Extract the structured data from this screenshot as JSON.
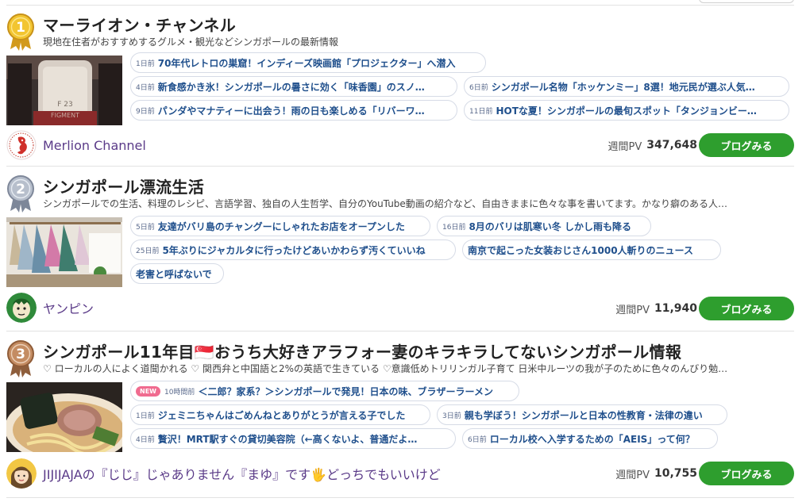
{
  "entries": [
    {
      "rank": "1",
      "medal_color": "#e3b12a",
      "title": "マーライオン・チャンネル",
      "description": "現地在住者がおすすめするグルメ・観光などシンガポールの最新情報",
      "articles": [
        {
          "ago": "1日前",
          "title": "70年代レトロの巣窟！インディーズ映画館「プロジェクター」へ潜入"
        },
        {
          "ago": "4日前",
          "title": "新食感かき氷！シンガポールの暑さに効く「味香園」のスノ…"
        },
        {
          "ago": "6日前",
          "title": "シンガポール名物「ホッケンミー」8選！地元民が選ぶ人気…"
        },
        {
          "ago": "9日前",
          "title": "パンダやマナティーに出会う！雨の日も楽しめる「リバーワ…"
        },
        {
          "ago": "11日前",
          "title": "HOTな夏！シンガポールの最旬スポット「タンジョンビー…"
        }
      ],
      "thumb_text": [
        "F 23",
        "FIGMENT"
      ],
      "owner": "Merlion Channel",
      "pv_label": "週間PV",
      "pv_value": "347,648",
      "button": "ブログみる"
    },
    {
      "rank": "2",
      "medal_color": "#9aa3b3",
      "title": "シンガポール漂流生活",
      "description": "シンガポールでの生活、料理のレシピ、言語学習、独自の人生哲学、自分のYouTube動画の紹介など、自由きままに色々な事を書いてます。かなり癖のある人…",
      "articles": [
        {
          "ago": "5日前",
          "title": "友達がバリ島のチャングーにしゃれたお店をオープンした"
        },
        {
          "ago": "16日前",
          "title": "8月のバリは肌寒い冬 しかし雨も降る"
        },
        {
          "ago": "25日前",
          "title": "5年ぶりにジャカルタに行ったけどあいかわらず汚くていいね"
        },
        {
          "ago": "",
          "title": "南京で起こった女装おじさん1000人斬りのニュース"
        },
        {
          "ago": "",
          "title": "老害と呼ばないで"
        }
      ],
      "owner": "ヤンピン",
      "pv_label": "週間PV",
      "pv_value": "11,940",
      "button": "ブログみる"
    },
    {
      "rank": "3",
      "medal_color": "#b9825a",
      "title": "シンガポール11年目🇸🇬おうち大好きアラフォー妻のキラキラしてないシンガポール情報",
      "description": "♡ ローカルの人によく道聞かれる ♡ 関西弁と中国語と2%の英語で生きている ♡意識低めトリリンガル子育て 日米中ルーツの我が子のために色々のんびり勉…",
      "articles": [
        {
          "badge": "NEW",
          "ago": "10時間前",
          "title": "＜二郎？家系？＞シンガポールで発見！日本の味、ブラザーラーメン"
        },
        {
          "ago": "1日前",
          "title": "ジェミニちゃんはごめんねとありがとうが言える子でした"
        },
        {
          "ago": "3日前",
          "title": "親も学ぼう！シンガポールと日本の性教育・法律の違い"
        },
        {
          "ago": "4日前",
          "title": "贅沢！MRT駅すぐの貸切美容院（←高くないよ、普通だよ…"
        },
        {
          "ago": "6日前",
          "title": "ローカル校へ入学するための「AEIS」って何？"
        }
      ],
      "owner": "JIJIJAJAの『じじ』じゃありません『まゆ』です🖐どっちでもいいけど",
      "pv_label": "週間PV",
      "pv_value": "10,755",
      "button": "ブログみる"
    }
  ]
}
